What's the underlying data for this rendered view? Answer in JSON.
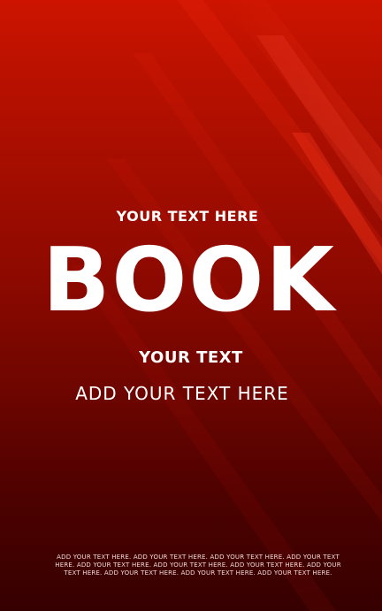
{
  "cover": {
    "top_line": "YOUR TEXT HERE",
    "title": "BOOK",
    "subtitle": "YOUR TEXT",
    "tagline": "ADD YOUR TEXT HERE",
    "fine_print": "ADD YOUR TEXT HERE. ADD YOUR TEXT HERE. ADD YOUR TEXT HERE. ADD YOUR TEXT HERE. ADD YOUR TEXT HERE. ADD YOUR TEXT HERE. ADD YOUR TEXT HERE. ADD YOUR TEXT HERE. ADD YOUR TEXT HERE. ADD YOUR TEXT HERE. ADD YOUR TEXT HERE."
  },
  "colors": {
    "background_top": "#cc1400",
    "background_bottom": "#530000",
    "highlight": "#ff2a10",
    "text": "#ffffff"
  }
}
